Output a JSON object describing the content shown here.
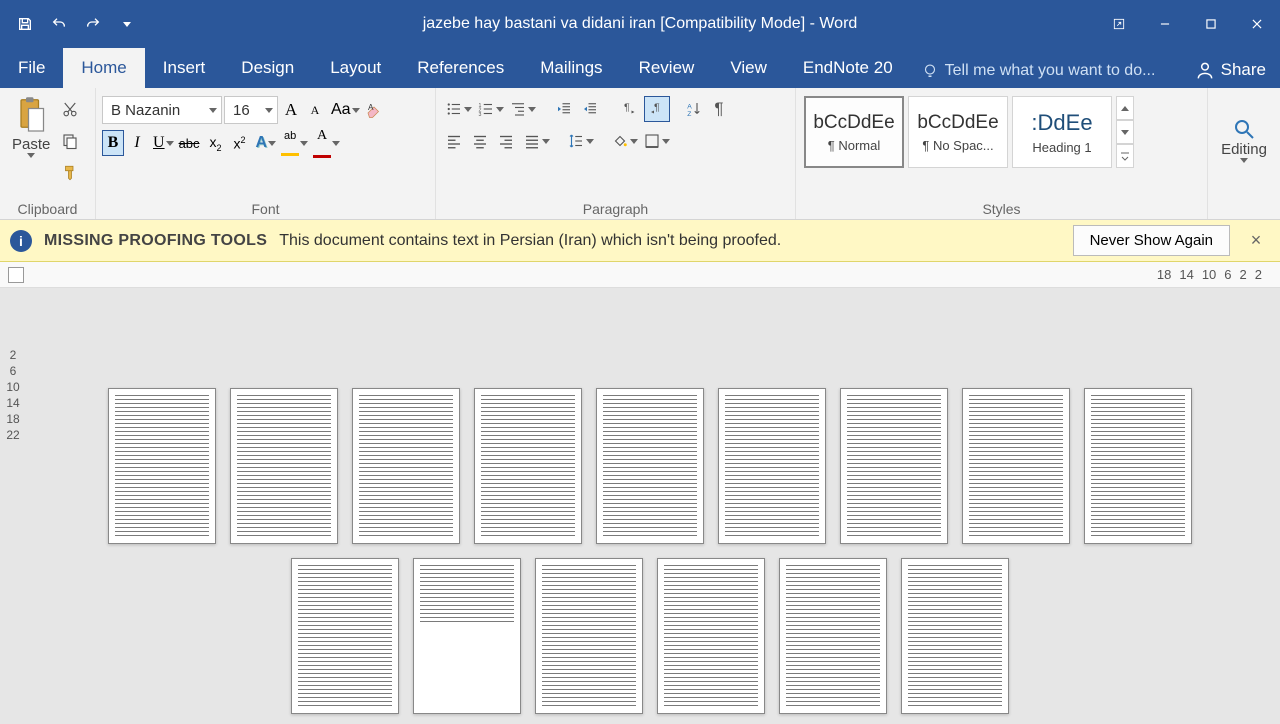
{
  "app": {
    "title": "jazebe hay bastani va didani iran [Compatibility Mode] - Word"
  },
  "tabs": {
    "file": "File",
    "home": "Home",
    "insert": "Insert",
    "design": "Design",
    "layout": "Layout",
    "references": "References",
    "mailings": "Mailings",
    "review": "Review",
    "view": "View",
    "endnote": "EndNote 20",
    "tellme": "Tell me what you want to do...",
    "share": "Share"
  },
  "ribbon": {
    "clipboard": {
      "label": "Clipboard",
      "paste": "Paste"
    },
    "font": {
      "label": "Font",
      "name": "B Nazanin",
      "size": "16",
      "aa": "Aa",
      "bigA": "A",
      "smallA": "A"
    },
    "paragraph": {
      "label": "Paragraph"
    },
    "styles": {
      "label": "Styles",
      "items": [
        {
          "preview": "bCcDdEe",
          "name": "¶ Normal",
          "selected": true,
          "blue": false
        },
        {
          "preview": "bCcDdEe",
          "name": "¶ No Spac...",
          "selected": false,
          "blue": false
        },
        {
          "preview": ":DdEe",
          "name": "Heading 1",
          "selected": false,
          "blue": true
        }
      ]
    },
    "editing": {
      "label": "Editing"
    }
  },
  "messagebar": {
    "title": "MISSING PROOFING TOOLS",
    "text": "This document contains text in Persian (Iran) which isn't being proofed.",
    "button": "Never Show Again"
  },
  "ruler": {
    "h": [
      "18",
      "14",
      "10",
      "6",
      "2",
      "2"
    ],
    "v": [
      "2",
      "6",
      "10",
      "14",
      "18",
      "22"
    ]
  }
}
